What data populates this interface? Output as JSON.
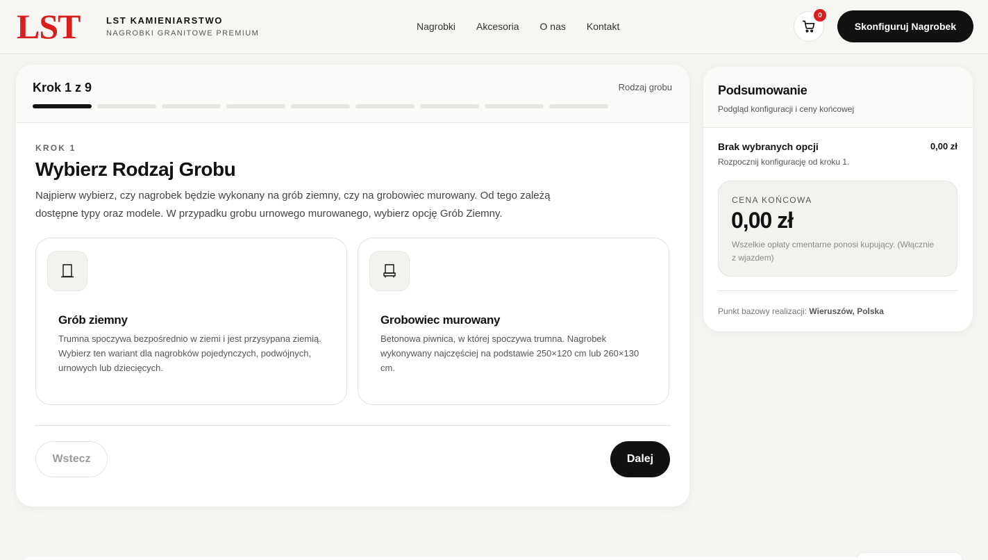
{
  "header": {
    "logo": "LST",
    "brand_name": "LST KAMIENIARSTWO",
    "brand_tagline": "NAGROBKI GRANITOWE PREMIUM",
    "nav": [
      "Nagrobki",
      "Akcesoria",
      "O nas",
      "Kontakt"
    ],
    "cart_count": "0",
    "cta_label": "Skonfiguruj Nagrobek",
    "accent_color": "#d81e1e"
  },
  "wizard": {
    "step_counter": "Krok 1 z 9",
    "step_name": "Rodzaj grobu",
    "progress_total": 9,
    "progress_current": 1,
    "eyebrow": "KROK 1",
    "title": "Wybierz Rodzaj Grobu",
    "description": "Najpierw wybierz, czy nagrobek będzie wykonany na grób ziemny, czy na grobowiec murowany. Od tego zależą dostępne typy oraz modele. W przypadku grobu urnowego murowanego, wybierz opcję Grób Ziemny.",
    "options": [
      {
        "icon": "grave-icon",
        "title": "Grób ziemny",
        "description": "Trumna spoczywa bezpośrednio w ziemi i jest przysypana ziemią. Wybierz ten wariant dla nagrobków pojedynczych, podwójnych, urnowych lub dziecięcych."
      },
      {
        "icon": "tomb-icon",
        "title": "Grobowiec murowany",
        "description": "Betonowa piwnica, w której spoczywa trumna. Nagrobek wykonywany najczęściej na podstawie 250×120 cm lub 260×130 cm."
      }
    ],
    "back_label": "Wstecz",
    "next_label": "Dalej"
  },
  "summary": {
    "title": "Podsumowanie",
    "subtitle": "Podgląd konfiguracji i ceny końcowej",
    "empty_label": "Brak wybranych opcji",
    "empty_value": "0,00 zł",
    "hint": "Rozpocznij konfigurację od kroku 1.",
    "price_label": "CENA KOŃCOWA",
    "price_value": "0,00 zł",
    "price_note": "Wszelkie opłaty cmentarne ponosi kupujący. (Włącznie z wjazdem)",
    "base_label": "Punkt bazowy realizacji:",
    "base_value": "Wieruszów, Polska"
  }
}
